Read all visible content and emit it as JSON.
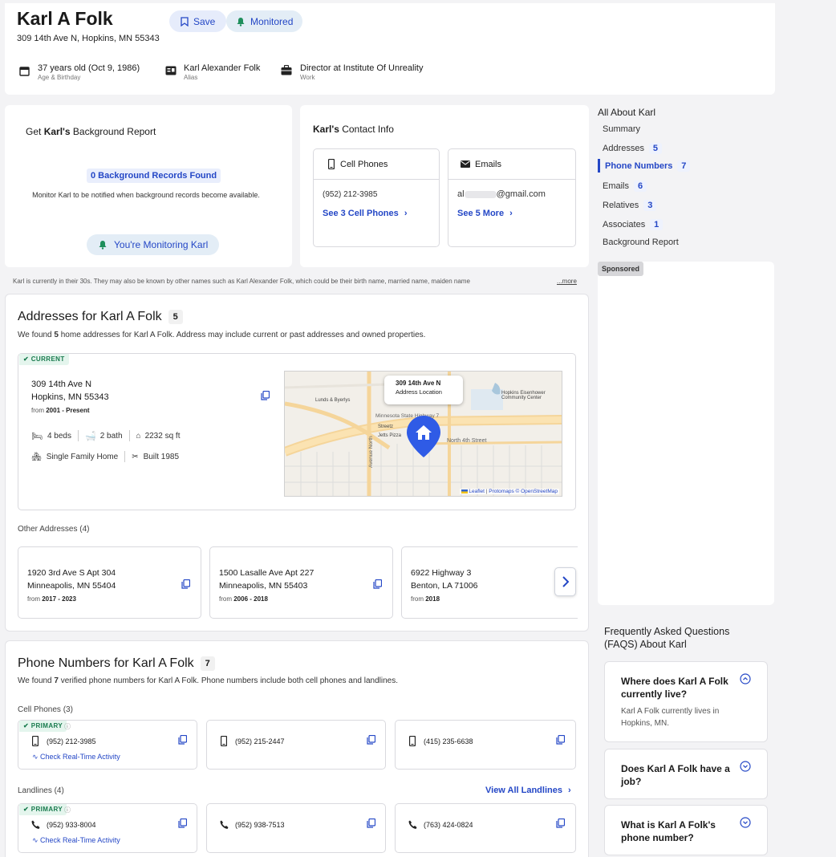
{
  "profile": {
    "name": "Karl A Folk",
    "address": "309 14th Ave N, Hopkins, MN 55343",
    "save_label": "Save",
    "monitored_label": "Monitored",
    "facts": [
      {
        "value": "37 years old (Oct 9, 1986)",
        "label": "Age & Birthday"
      },
      {
        "value": "Karl Alexander Folk",
        "label": "Alias"
      },
      {
        "value": "Director at Institute Of Unreality",
        "label": "Work"
      }
    ]
  },
  "background": {
    "title_prefix": "Get ",
    "title_name": "Karl's",
    "title_suffix": " Background Report",
    "records_found": "0 Background Records Found",
    "monitor_text": "Monitor Karl to be notified when background records become available.",
    "monitoring_label": "You're Monitoring Karl"
  },
  "contact": {
    "title_name": "Karl's",
    "title_suffix": " Contact Info",
    "phones": {
      "header": "Cell Phones",
      "value": "(952) 212-3985",
      "link": "See 3 Cell Phones"
    },
    "emails": {
      "header": "Emails",
      "prefix": "al",
      "suffix": "@gmail.com",
      "link": "See 5 More"
    }
  },
  "summary_text": "Karl is currently in their 30s. They may also be known by other names such as Karl Alexander Folk, which could be their birth name, married name, maiden name",
  "more_label": "...more",
  "addresses": {
    "title": "Addresses for Karl A Folk",
    "count": "5",
    "desc_pre": "We found ",
    "desc_num": "5",
    "desc_post": " home addresses for Karl A Folk. Address may include current or past addresses and owned properties.",
    "current": {
      "tag": "CURRENT",
      "line1": "309 14th Ave N",
      "line2": "Hopkins, MN 55343",
      "from_label": "from ",
      "years": "2001 - Present",
      "beds": "4 beds",
      "baths": "2 bath",
      "sqft": "2232 sq ft",
      "type": "Single Family Home",
      "built": "Built 1985"
    },
    "map": {
      "popup_line1": "309 14th Ave N",
      "popup_line2": "Address Location",
      "labels": {
        "lunds": "Lunds & Byerlys",
        "hopkins": "Hopkins Eisenhower Community Center",
        "minnesota": "Minnesota State Highway 7",
        "streetz": "Streetz",
        "jetts": "Jetts Pizza",
        "north4": "North 4th Street",
        "avenue": "Avenue North"
      },
      "attr_leaflet": "Leaflet",
      "attr_sep": " | ",
      "attr_proto": "Protomaps",
      "attr_osm": " © OpenStreetMap"
    },
    "other_label": "Other Addresses (4)",
    "others": [
      {
        "line1": "1920 3rd Ave S Apt 304",
        "line2": "Minneapolis, MN 55404",
        "from": "from ",
        "years": "2017 - 2023"
      },
      {
        "line1": "1500 Lasalle Ave Apt 227",
        "line2": "Minneapolis, MN 55403",
        "from": "from ",
        "years": "2006 - 2018"
      },
      {
        "line1": "6922 Highway 3",
        "line2": "Benton, LA 71006",
        "from": "from ",
        "years": "2018"
      }
    ]
  },
  "phones": {
    "title": "Phone Numbers for Karl A Folk",
    "count": "7",
    "desc_pre": "We found ",
    "desc_num": "7",
    "desc_post": " verified phone numbers for Karl A Folk. Phone numbers include both cell phones and landlines.",
    "cell_label": "Cell Phones (3)",
    "primary_tag": "PRIMARY",
    "activity_link": "Check Real-Time Activity",
    "cells": [
      "(952) 212-3985",
      "(952) 215-2447",
      "(415) 235-6638"
    ],
    "landline_label": "Landlines (4)",
    "view_all": "View All Landlines",
    "landlines": [
      "(952) 933-8004",
      "(952) 938-7513",
      "(763) 424-0824"
    ]
  },
  "sidebar": {
    "title": "All About Karl",
    "items": [
      {
        "label": "Summary",
        "count": ""
      },
      {
        "label": "Addresses",
        "count": "5"
      },
      {
        "label": "Phone Numbers",
        "count": "7"
      },
      {
        "label": "Emails",
        "count": "6"
      },
      {
        "label": "Relatives",
        "count": "3"
      },
      {
        "label": "Associates",
        "count": "1"
      },
      {
        "label": "Background Report",
        "count": ""
      }
    ],
    "sponsored": "Sponsored"
  },
  "faq": {
    "title": "Frequently Asked Questions (FAQS) About Karl",
    "items": [
      {
        "q": "Where does Karl A Folk currently live?",
        "a": "Karl A Folk currently lives in Hopkins, MN."
      },
      {
        "q": "Does Karl A Folk have a job?"
      },
      {
        "q": "What is Karl A Folk's phone number?"
      }
    ]
  },
  "colors": {
    "accent": "#2447c6",
    "tag_green": "#187a4d",
    "map_pin": "#2f5be6"
  }
}
